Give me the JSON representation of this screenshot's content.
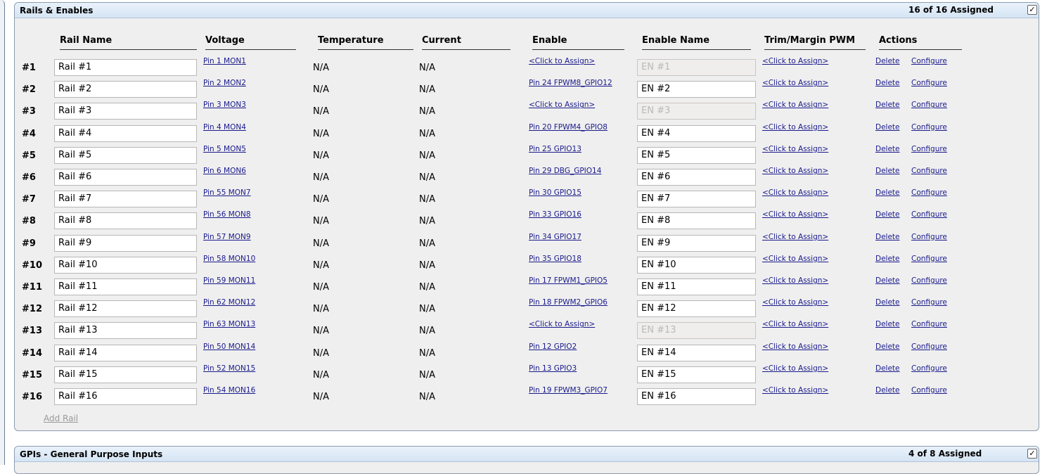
{
  "rails_panel": {
    "title": "Rails & Enables",
    "assigned": "16 of 16 Assigned",
    "check_glyph": "✓",
    "columns": [
      "Rail Name",
      "Voltage",
      "Temperature",
      "Current",
      "Enable",
      "Enable Name",
      "Trim/Margin PWM",
      "Actions"
    ],
    "rows": [
      {
        "num": "#1",
        "rail": "Rail #1",
        "voltage": "Pin 1 MON1",
        "temp": "N/A",
        "current": "N/A",
        "enable": "<Click to Assign>",
        "en_name": "EN #1",
        "en_disabled": true,
        "trim": "<Click to Assign>",
        "delete": "Delete",
        "configure": "Configure"
      },
      {
        "num": "#2",
        "rail": "Rail #2",
        "voltage": "Pin 2 MON2",
        "temp": "N/A",
        "current": "N/A",
        "enable": "Pin 24 FPWM8_GPIO12",
        "en_name": "EN #2",
        "en_disabled": false,
        "trim": "<Click to Assign>",
        "delete": "Delete",
        "configure": "Configure"
      },
      {
        "num": "#3",
        "rail": "Rail #3",
        "voltage": "Pin 3 MON3",
        "temp": "N/A",
        "current": "N/A",
        "enable": "<Click to Assign>",
        "en_name": "EN #3",
        "en_disabled": true,
        "trim": "<Click to Assign>",
        "delete": "Delete",
        "configure": "Configure"
      },
      {
        "num": "#4",
        "rail": "Rail #4",
        "voltage": "Pin 4 MON4",
        "temp": "N/A",
        "current": "N/A",
        "enable": "Pin 20 FPWM4_GPIO8",
        "en_name": "EN #4",
        "en_disabled": false,
        "trim": "<Click to Assign>",
        "delete": "Delete",
        "configure": "Configure"
      },
      {
        "num": "#5",
        "rail": "Rail #5",
        "voltage": "Pin 5 MON5",
        "temp": "N/A",
        "current": "N/A",
        "enable": "Pin 25 GPIO13",
        "en_name": "EN #5",
        "en_disabled": false,
        "trim": "<Click to Assign>",
        "delete": "Delete",
        "configure": "Configure"
      },
      {
        "num": "#6",
        "rail": "Rail #6",
        "voltage": "Pin 6 MON6",
        "temp": "N/A",
        "current": "N/A",
        "enable": "Pin 29 DBG_GPIO14",
        "en_name": "EN #6",
        "en_disabled": false,
        "trim": "<Click to Assign>",
        "delete": "Delete",
        "configure": "Configure"
      },
      {
        "num": "#7",
        "rail": "Rail #7",
        "voltage": "Pin 55 MON7",
        "temp": "N/A",
        "current": "N/A",
        "enable": "Pin 30 GPIO15",
        "en_name": "EN #7",
        "en_disabled": false,
        "trim": "<Click to Assign>",
        "delete": "Delete",
        "configure": "Configure"
      },
      {
        "num": "#8",
        "rail": "Rail #8",
        "voltage": "Pin 56 MON8",
        "temp": "N/A",
        "current": "N/A",
        "enable": "Pin 33 GPIO16",
        "en_name": "EN #8",
        "en_disabled": false,
        "trim": "<Click to Assign>",
        "delete": "Delete",
        "configure": "Configure"
      },
      {
        "num": "#9",
        "rail": "Rail #9",
        "voltage": "Pin 57 MON9",
        "temp": "N/A",
        "current": "N/A",
        "enable": "Pin 34 GPIO17",
        "en_name": "EN #9",
        "en_disabled": false,
        "trim": "<Click to Assign>",
        "delete": "Delete",
        "configure": "Configure"
      },
      {
        "num": "#10",
        "rail": "Rail #10",
        "voltage": "Pin 58 MON10",
        "temp": "N/A",
        "current": "N/A",
        "enable": "Pin 35 GPIO18",
        "en_name": "EN #10",
        "en_disabled": false,
        "trim": "<Click to Assign>",
        "delete": "Delete",
        "configure": "Configure"
      },
      {
        "num": "#11",
        "rail": "Rail #11",
        "voltage": "Pin 59 MON11",
        "temp": "N/A",
        "current": "N/A",
        "enable": "Pin 17 FPWM1_GPIO5",
        "en_name": "EN #11",
        "en_disabled": false,
        "trim": "<Click to Assign>",
        "delete": "Delete",
        "configure": "Configure"
      },
      {
        "num": "#12",
        "rail": "Rail #12",
        "voltage": "Pin 62 MON12",
        "temp": "N/A",
        "current": "N/A",
        "enable": "Pin 18 FPWM2_GPIO6",
        "en_name": "EN #12",
        "en_disabled": false,
        "trim": "<Click to Assign>",
        "delete": "Delete",
        "configure": "Configure"
      },
      {
        "num": "#13",
        "rail": "Rail #13",
        "voltage": "Pin 63 MON13",
        "temp": "N/A",
        "current": "N/A",
        "enable": "<Click to Assign>",
        "en_name": "EN #13",
        "en_disabled": true,
        "trim": "<Click to Assign>",
        "delete": "Delete",
        "configure": "Configure"
      },
      {
        "num": "#14",
        "rail": "Rail #14",
        "voltage": "Pin 50 MON14",
        "temp": "N/A",
        "current": "N/A",
        "enable": "Pin 12 GPIO2",
        "en_name": "EN #14",
        "en_disabled": false,
        "trim": "<Click to Assign>",
        "delete": "Delete",
        "configure": "Configure"
      },
      {
        "num": "#15",
        "rail": "Rail #15",
        "voltage": "Pin 52 MON15",
        "temp": "N/A",
        "current": "N/A",
        "enable": "Pin 13 GPIO3",
        "en_name": "EN #15",
        "en_disabled": false,
        "trim": "<Click to Assign>",
        "delete": "Delete",
        "configure": "Configure"
      },
      {
        "num": "#16",
        "rail": "Rail #16",
        "voltage": "Pin 54 MON16",
        "temp": "N/A",
        "current": "N/A",
        "enable": "Pin 19 FPWM3_GPIO7",
        "en_name": "EN #16",
        "en_disabled": false,
        "trim": "<Click to Assign>",
        "delete": "Delete",
        "configure": "Configure"
      }
    ],
    "add_rail": "Add Rail"
  },
  "gpi_panel": {
    "title": "GPIs - General Purpose Inputs",
    "assigned": "4 of 8 Assigned",
    "check_glyph": "✓"
  }
}
